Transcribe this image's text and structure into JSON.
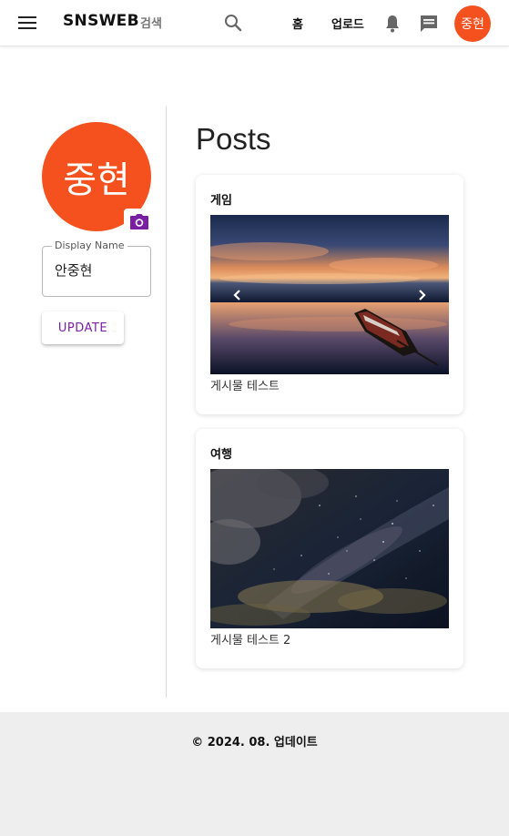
{
  "header": {
    "brand": "SNSWEB",
    "search_label": "검색",
    "nav_home": "홈",
    "nav_upload": "업로드",
    "avatar_text": "중현",
    "icons": {
      "menu": "menu-icon",
      "search": "search-icon",
      "notifications": "bell-icon",
      "messages": "chat-icon"
    }
  },
  "profile": {
    "avatar_text": "중현",
    "camera_icon": "camera-icon",
    "display_name_label": "Display Name",
    "display_name_value": "안중현",
    "update_label": "UPDATE"
  },
  "posts": {
    "title": "Posts",
    "items": [
      {
        "title": "게임",
        "caption": "게시물 테스트",
        "has_carousel": true
      },
      {
        "title": "여행",
        "caption": "게시물 테스트 2",
        "has_carousel": false
      }
    ]
  },
  "footer": {
    "text": "© 2024. 08. 업데이트"
  },
  "colors": {
    "avatar": "#f4511e",
    "accent": "#7b1fa2",
    "footer_bg": "#eeeeee"
  }
}
